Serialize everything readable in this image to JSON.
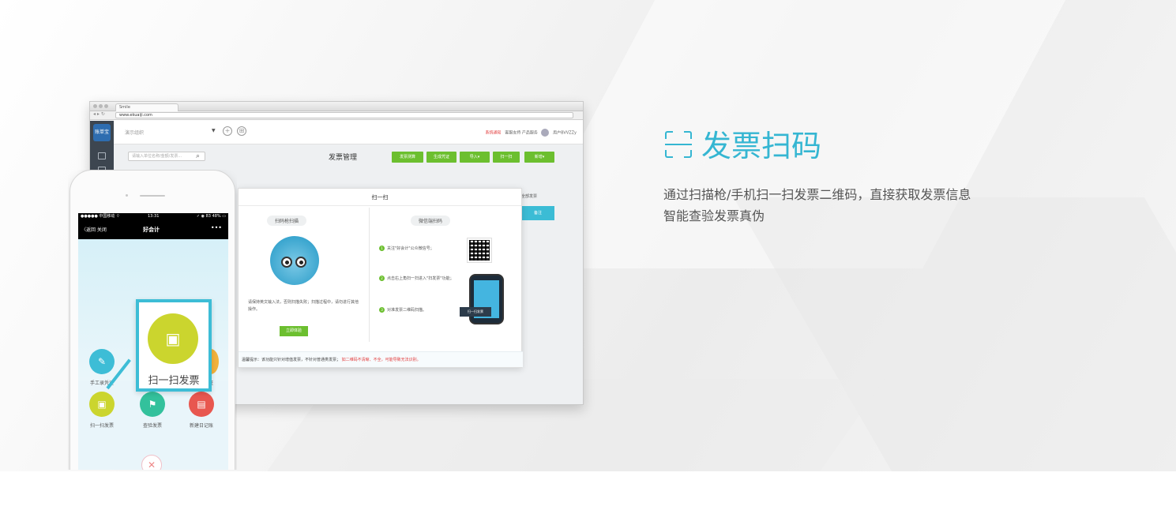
{
  "browser": {
    "tab_title": "Smile",
    "address": "www.ekuaiji.com"
  },
  "app": {
    "logo_text": "账单宝",
    "company_select": "演示组织",
    "notice_text": "系统通知",
    "links": "客服支持   产品服务",
    "user": "用户BVVZZy",
    "search_placeholder": "请输入单位名称/金额/发票...",
    "page_title": "发票管理",
    "buttons": [
      "发票测算",
      "生成凭证",
      "导入▾",
      "扫一扫",
      "新增▾"
    ],
    "right_tag": "全部发票",
    "right_button": "备注"
  },
  "modal": {
    "title": "扫一扫",
    "left_title": "扫码枪扫描",
    "right_title": "微信端扫码",
    "left_note": "请保持英文输入法，否则扫描失败；扫描过程中，请勿进行其他操作。",
    "try_button": "立即体验",
    "steps": [
      "关注\"好会计\"公众微信号；",
      "点击右上角扫一扫进入\"扫发票\"功能；",
      "对准发票二维码扫描。"
    ],
    "scan_tag": "扫一扫发票",
    "footer_label": "温馨提示：该功能只针对增值发票，不针对普通类发票；",
    "footer_warning": "如二维码不清晰、不全，可能导致无法识别。"
  },
  "phone": {
    "carrier": "●●●●● 中国移动 ⌔",
    "time": "13:31",
    "battery": "✓ ◉ 83 48% ▭",
    "back": "〈返回  关闭",
    "title": "好会计",
    "more": "•••",
    "items": [
      {
        "label": "手工录凭证",
        "color": "#3dbdd6",
        "icon": "✎"
      },
      {
        "label": "扫一扫发票",
        "color": "#cbd52e",
        "icon": "▣"
      },
      {
        "label": "查验发票",
        "color": "#33c19c",
        "icon": "⚑"
      },
      {
        "label": "新建日记账",
        "color": "#e8574f",
        "icon": "▤"
      }
    ],
    "callout_label": "扫一扫发票",
    "partial_right_label": "证"
  },
  "feature": {
    "title": "发票扫码",
    "desc_line1": "通过扫描枪/手机扫一扫发票二维码，直接获取发票信息",
    "desc_line2": "智能查验发票真伪",
    "accent_color": "#35b6d2"
  }
}
